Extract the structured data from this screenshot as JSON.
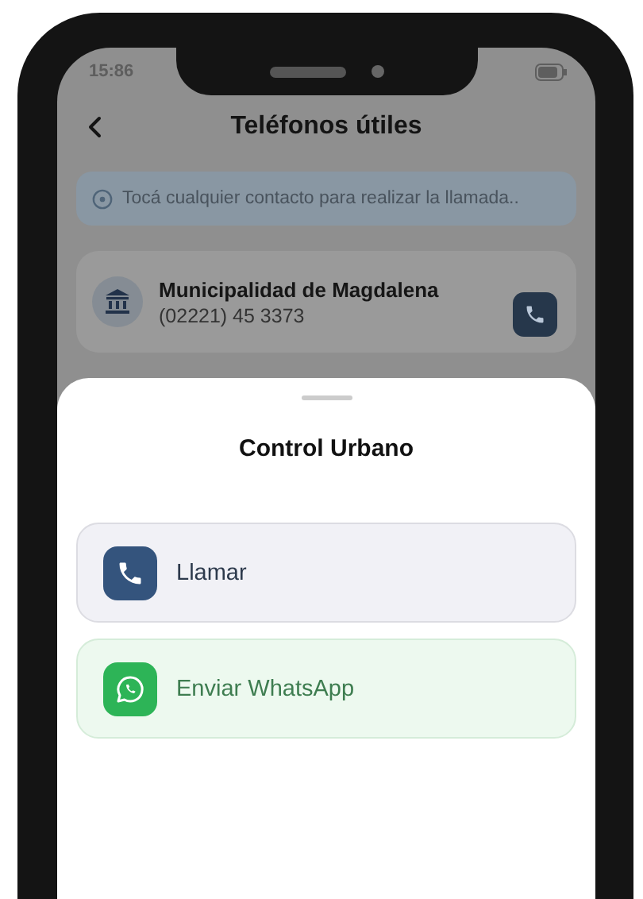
{
  "status_bar": {
    "time": "15:86"
  },
  "header": {
    "title": "Teléfonos útiles"
  },
  "hint": {
    "text": "Tocá cualquier contacto para realizar la llamada.."
  },
  "contacts": [
    {
      "name": "Municipalidad de Magdalena",
      "phone": "(02221) 45 3373"
    }
  ],
  "sheet": {
    "title": "Control Urbano",
    "actions": [
      {
        "kind": "call",
        "label": "Llamar"
      },
      {
        "kind": "whatsapp",
        "label": "Enviar WhatsApp"
      }
    ]
  }
}
